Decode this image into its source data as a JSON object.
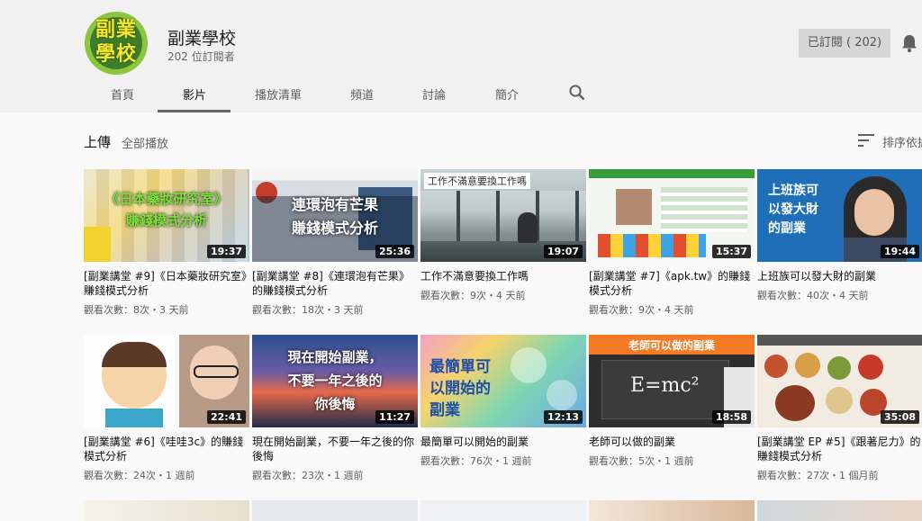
{
  "channel": {
    "name": "副業學校",
    "subscribers": "202 位訂閱者",
    "avatar_text": [
      "副業",
      "學校"
    ],
    "subscribe_button": "已訂閱 ( 202)"
  },
  "tabs": [
    {
      "label": "首頁"
    },
    {
      "label": "影片"
    },
    {
      "label": "播放清單"
    },
    {
      "label": "頻道"
    },
    {
      "label": "討論"
    },
    {
      "label": "簡介"
    }
  ],
  "section": {
    "title": "上傳",
    "play_all": "全部播放",
    "sort_label": "排序依據"
  },
  "thumb_overlays": {
    "v1": [
      "《日本藥妝研究室》",
      "賺錢模式分析"
    ],
    "v2": [
      "連環泡有芒果",
      "賺錢模式分析"
    ],
    "v3": "工作不滿意要換工作嗎",
    "v5": [
      "上班族可",
      "以發大財",
      "的副業"
    ],
    "v7": [
      "現在開始副業，",
      "不要一年之後的",
      "你後悔"
    ],
    "v8": [
      "最簡單可",
      "以開始的",
      "副業"
    ],
    "v9": "老師可以做的副業",
    "v9_board": "E=mc²"
  },
  "videos": [
    {
      "title": "[副業講堂 #9]《日本藥妝研究室》賺錢模式分析",
      "meta": "觀看次數：8次・3 天前",
      "duration": "19:37"
    },
    {
      "title": "[副業講堂 #8]《連環泡有芒果》的賺錢模式分析",
      "meta": "觀看次數：18次・3 天前",
      "duration": "25:36"
    },
    {
      "title": "工作不滿意要換工作嗎",
      "meta": "觀看次數：9次・4 天前",
      "duration": "19:07"
    },
    {
      "title": "[副業講堂 #7]《apk.tw》的賺錢模式分析",
      "meta": "觀看次數：9次・4 天前",
      "duration": "15:37"
    },
    {
      "title": "上班族可以發大財的副業",
      "meta": "觀看次數：40次・4 天前",
      "duration": "19:44"
    },
    {
      "title": "[副業講堂 #6]《哇哇3c》的賺錢模式分析",
      "meta": "觀看次數：24次・1 週前",
      "duration": "22:41"
    },
    {
      "title": "現在開始副業，不要一年之後的你後悔",
      "meta": "觀看次數：23次・1 週前",
      "duration": "11:27"
    },
    {
      "title": "最簡單可以開始的副業",
      "meta": "觀看次數：76次・1 週前",
      "duration": "12:13"
    },
    {
      "title": "老師可以做的副業",
      "meta": "觀看次數：5次・1 週前",
      "duration": "18:58"
    },
    {
      "title": "[副業講堂 EP #5]《跟著尼力》的賺錢模式分析",
      "meta": "觀看次數：27次・1 個月前",
      "duration": "35:08"
    }
  ],
  "colors": {
    "header_bg": "#f1f1f1",
    "page_bg": "#f9f9f9",
    "subscribe_bg": "#d6d6d6",
    "duration_bg": "#000000"
  },
  "icons": [
    "search-icon",
    "bell-icon",
    "sort-icon"
  ]
}
